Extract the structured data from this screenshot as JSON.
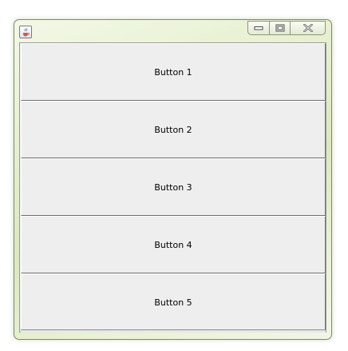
{
  "window": {
    "title": "",
    "app_icon": "java-cup-icon",
    "caption_icons": [
      "minimize-icon",
      "maximize-icon",
      "close-icon"
    ]
  },
  "buttons": [
    {
      "label": "Button 1"
    },
    {
      "label": "Button 2"
    },
    {
      "label": "Button 3"
    },
    {
      "label": "Button 4"
    },
    {
      "label": "Button 5"
    }
  ],
  "colors": {
    "frame_tint": "#dbe9bc",
    "client_bg": "#f0f0f0",
    "button_bg": "#eeeeee"
  }
}
